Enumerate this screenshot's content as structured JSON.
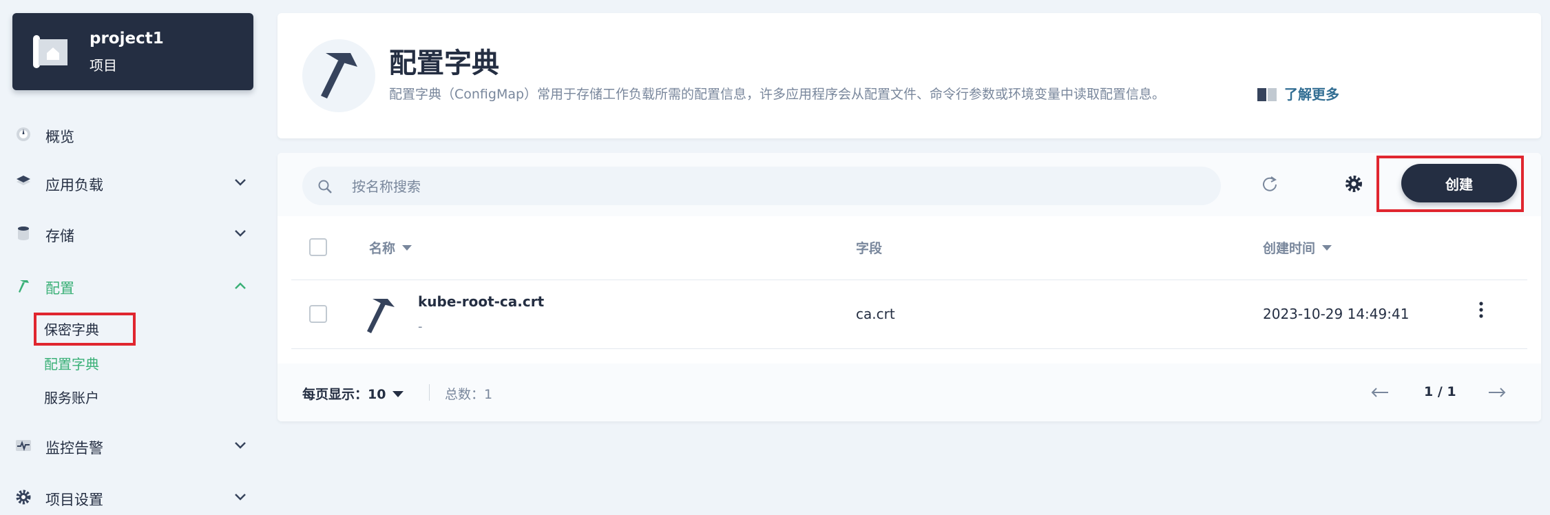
{
  "project": {
    "name": "project1",
    "type": "项目",
    "icon": "project-icon"
  },
  "sidebar": {
    "items": [
      {
        "label": "概览",
        "icon": "dashboard-icon"
      },
      {
        "label": "应用负载",
        "icon": "layers-icon"
      },
      {
        "label": "存储",
        "icon": "database-icon"
      },
      {
        "label": "配置",
        "icon": "hammer-icon",
        "expanded": true,
        "children": [
          {
            "label": "保密字典"
          },
          {
            "label": "配置字典",
            "active": true
          },
          {
            "label": "服务账户"
          }
        ]
      },
      {
        "label": "监控告警",
        "icon": "monitor-icon"
      },
      {
        "label": "项目设置",
        "icon": "gear-icon"
      }
    ]
  },
  "header": {
    "title": "配置字典",
    "description": "配置字典（ConfigMap）常用于存储工作负载所需的配置信息，许多应用程序会从配置文件、命令行参数或环境变量中读取配置信息。",
    "learn_more": "了解更多"
  },
  "toolbar": {
    "search_placeholder": "按名称搜索",
    "create_label": "创建"
  },
  "table": {
    "columns": [
      "名称",
      "字段",
      "创建时间"
    ],
    "rows": [
      {
        "name": "kube-root-ca.crt",
        "description": "-",
        "field": "ca.crt",
        "created": "2023-10-29 14:49:41"
      }
    ]
  },
  "pagination": {
    "per_page_label": "每页显示：",
    "per_page_value": "10",
    "total": "总数：1",
    "page": "1 / 1"
  },
  "colors": {
    "dark": "#242e42",
    "accent_green": "#3ab077",
    "highlight_red": "#e0262f",
    "link_blue": "#326e93"
  }
}
